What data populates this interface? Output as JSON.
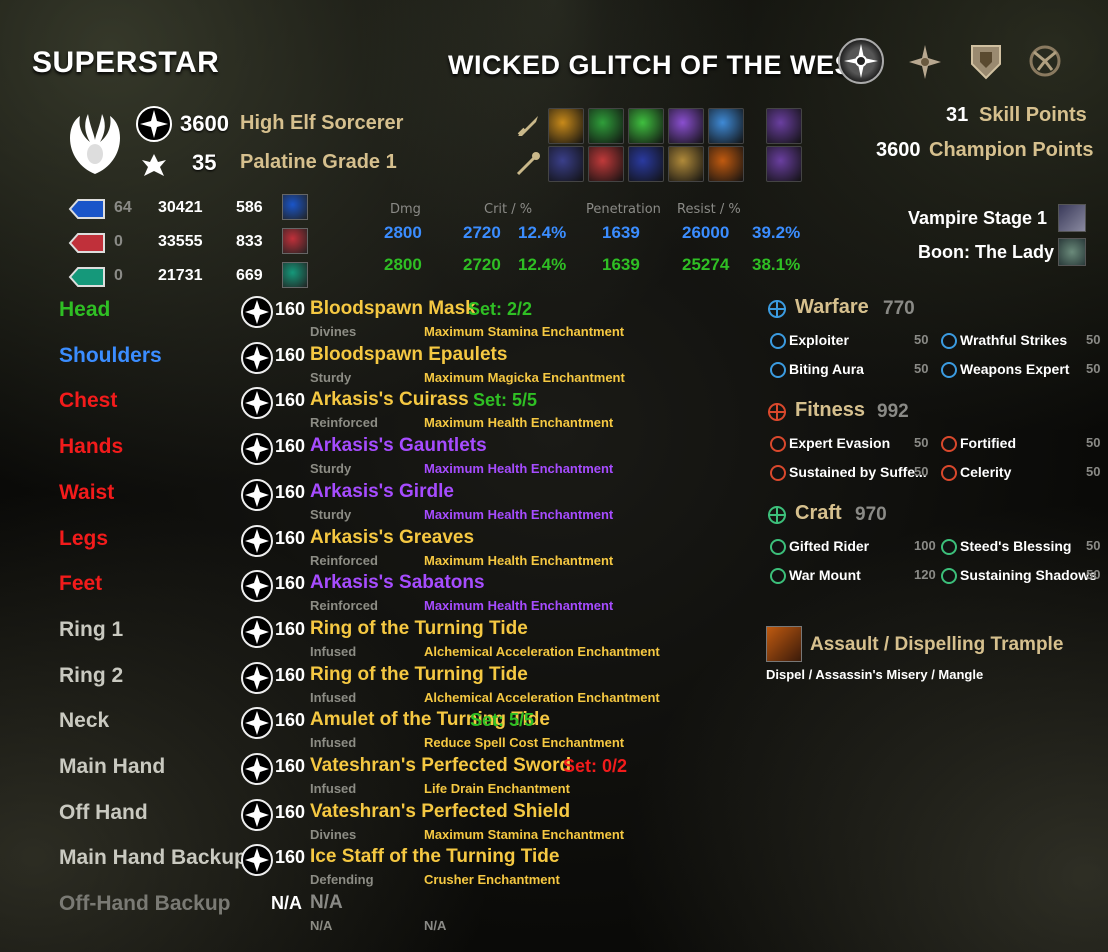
{
  "header": {
    "character_name": "SUPERSTAR",
    "title": "WICKED GLITCH OF THE WEST"
  },
  "character": {
    "champion_level": "3600",
    "race_class": "High Elf Sorcerer",
    "rank": "35",
    "rank_title": "Palatine Grade 1",
    "skill_points_value": "31",
    "skill_points_label": "Skill Points",
    "champion_points_value": "3600",
    "champion_points_label": "Champion Points",
    "vampire": "Vampire Stage 1",
    "boon": "Boon: The Lady"
  },
  "attributes": [
    {
      "points": "64",
      "max": "30421",
      "regen": "586",
      "color": "#1a55c9"
    },
    {
      "points": "0",
      "max": "33555",
      "regen": "833",
      "color": "#c0303a"
    },
    {
      "points": "0",
      "max": "21731",
      "regen": "669",
      "color": "#15987a"
    }
  ],
  "stats": {
    "headers": {
      "dmg": "Dmg",
      "crit": "Crit / %",
      "pen": "Penetration",
      "resist": "Resist / %"
    },
    "magic": {
      "dmg": "2800",
      "crit": "2720",
      "crit_pct": "12.4%",
      "pen": "1639",
      "resist": "26000",
      "resist_pct": "39.2%"
    },
    "physical": {
      "dmg": "2800",
      "crit": "2720",
      "crit_pct": "12.4%",
      "pen": "1639",
      "resist": "25274",
      "resist_pct": "38.1%"
    }
  },
  "equipment": [
    {
      "slot": "Head",
      "slot_color": "#2fbf24",
      "cp": "160",
      "name": "Bloodspawn Mask",
      "name_color": "#f5c842",
      "set": "Set: 2/2",
      "set_color": "#2fbf24",
      "trait": "Divines",
      "enchant": "Maximum Stamina Enchantment",
      "enchant_color": "#f5c842"
    },
    {
      "slot": "Shoulders",
      "slot_color": "#3b8dff",
      "cp": "160",
      "name": "Bloodspawn Epaulets",
      "name_color": "#f5c842",
      "set": "",
      "set_color": "#2fbf24",
      "trait": "Sturdy",
      "enchant": "Maximum Magicka Enchantment",
      "enchant_color": "#f5c842"
    },
    {
      "slot": "Chest",
      "slot_color": "#f21b1b",
      "cp": "160",
      "name": "Arkasis's Cuirass",
      "name_color": "#f5c842",
      "set": "Set: 5/5",
      "set_color": "#2fbf24",
      "trait": "Reinforced",
      "enchant": "Maximum Health Enchantment",
      "enchant_color": "#f5c842"
    },
    {
      "slot": "Hands",
      "slot_color": "#f21b1b",
      "cp": "160",
      "name": "Arkasis's Gauntlets",
      "name_color": "#a64cff",
      "set": "",
      "set_color": "#2fbf24",
      "trait": "Sturdy",
      "enchant": "Maximum Health Enchantment",
      "enchant_color": "#a64cff"
    },
    {
      "slot": "Waist",
      "slot_color": "#f21b1b",
      "cp": "160",
      "name": "Arkasis's Girdle",
      "name_color": "#a64cff",
      "set": "",
      "set_color": "#2fbf24",
      "trait": "Sturdy",
      "enchant": "Maximum Health Enchantment",
      "enchant_color": "#a64cff"
    },
    {
      "slot": "Legs",
      "slot_color": "#f21b1b",
      "cp": "160",
      "name": "Arkasis's Greaves",
      "name_color": "#f5c842",
      "set": "",
      "set_color": "#2fbf24",
      "trait": "Reinforced",
      "enchant": "Maximum Health Enchantment",
      "enchant_color": "#f5c842"
    },
    {
      "slot": "Feet",
      "slot_color": "#f21b1b",
      "cp": "160",
      "name": "Arkasis's Sabatons",
      "name_color": "#a64cff",
      "set": "",
      "set_color": "#2fbf24",
      "trait": "Reinforced",
      "enchant": "Maximum Health Enchantment",
      "enchant_color": "#a64cff"
    },
    {
      "slot": "Ring 1",
      "slot_color": "#c9c9c0",
      "cp": "160",
      "name": "Ring of the Turning Tide",
      "name_color": "#f5c842",
      "set": "",
      "set_color": "#2fbf24",
      "trait": "Infused",
      "enchant": "Alchemical Acceleration Enchantment",
      "enchant_color": "#f5c842"
    },
    {
      "slot": "Ring 2",
      "slot_color": "#c9c9c0",
      "cp": "160",
      "name": "Ring of the Turning Tide",
      "name_color": "#f5c842",
      "set": "",
      "set_color": "#2fbf24",
      "trait": "Infused",
      "enchant": "Alchemical Acceleration Enchantment",
      "enchant_color": "#f5c842"
    },
    {
      "slot": "Neck",
      "slot_color": "#c9c9c0",
      "cp": "160",
      "name": "Amulet of the Turning Tide",
      "name_color": "#f5c842",
      "set": "Set: 5/5",
      "set_color": "#2fbf24",
      "trait": "Infused",
      "enchant": "Reduce Spell Cost Enchantment",
      "enchant_color": "#f5c842"
    },
    {
      "slot": "Main Hand",
      "slot_color": "#c9c9c0",
      "cp": "160",
      "name": "Vateshran's Perfected Sword",
      "name_color": "#f5c842",
      "set": "Set: 0/2",
      "set_color": "#f21b1b",
      "trait": "Infused",
      "enchant": "Life Drain Enchantment",
      "enchant_color": "#f5c842"
    },
    {
      "slot": "Off Hand",
      "slot_color": "#c9c9c0",
      "cp": "160",
      "name": "Vateshran's Perfected Shield",
      "name_color": "#f5c842",
      "set": "",
      "set_color": "#2fbf24",
      "trait": "Divines",
      "enchant": "Maximum Stamina Enchantment",
      "enchant_color": "#f5c842"
    },
    {
      "slot": "Main Hand Backup",
      "slot_color": "#c9c9c0",
      "cp": "160",
      "name": "Ice Staff of the Turning Tide",
      "name_color": "#f5c842",
      "set": "",
      "set_color": "#2fbf24",
      "trait": "Defending",
      "enchant": "Crusher Enchantment",
      "enchant_color": "#f5c842"
    },
    {
      "slot": "Off-Hand Backup",
      "slot_color": "#7a7a74",
      "cp": "N/A",
      "name": "N/A",
      "name_color": "#8a8a86",
      "set": "",
      "set_color": "#2fbf24",
      "trait": "N/A",
      "enchant": "N/A",
      "enchant_color": "#8a8a86"
    }
  ],
  "champion": [
    {
      "name": "Warfare",
      "points": "770",
      "icon": "warfare-icon",
      "color": "#3b9be0",
      "perks": [
        {
          "name": "Exploiter",
          "value": "50"
        },
        {
          "name": "Wrathful Strikes",
          "value": "50"
        },
        {
          "name": "Biting Aura",
          "value": "50"
        },
        {
          "name": "Weapons Expert",
          "value": "50"
        }
      ]
    },
    {
      "name": "Fitness",
      "points": "992",
      "icon": "fitness-icon",
      "color": "#d9482c",
      "perks": [
        {
          "name": "Expert Evasion",
          "value": "50"
        },
        {
          "name": "Fortified",
          "value": "50"
        },
        {
          "name": "Sustained by Suffe...",
          "value": "50"
        },
        {
          "name": "Celerity",
          "value": "50"
        }
      ]
    },
    {
      "name": "Craft",
      "points": "970",
      "icon": "craft-icon",
      "color": "#3cbf7a",
      "perks": [
        {
          "name": "Gifted Rider",
          "value": "100"
        },
        {
          "name": "Steed's Blessing",
          "value": "50"
        },
        {
          "name": "War Mount",
          "value": "120"
        },
        {
          "name": "Sustaining Shadows",
          "value": "50"
        }
      ]
    }
  ],
  "mount": {
    "title": "Assault / Dispelling Trample",
    "subtitle": "Dispel / Assassin's Misery / Mangle"
  },
  "skill_bar_1": [
    "#c88a1a",
    "#2f9e3a",
    "#3fbf3f",
    "#8a4fd0",
    "#3f8ad6",
    "#6a3fa0"
  ],
  "skill_bar_2": [
    "#3a3f8a",
    "#c03a3a",
    "#2a3aa0",
    "#b08a3a",
    "#c05a10",
    "#6a3fa0"
  ]
}
